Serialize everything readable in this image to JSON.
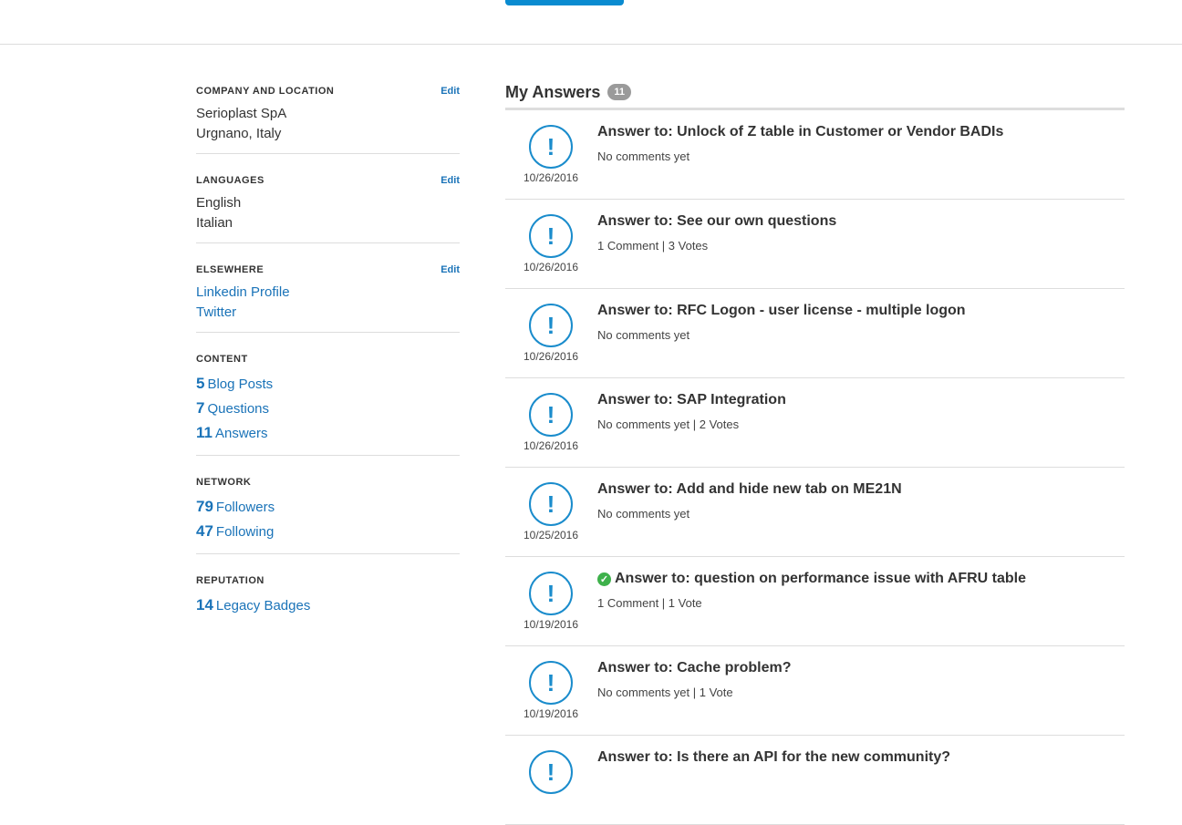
{
  "sidebar": {
    "edit_label": "Edit",
    "company": {
      "title": "COMPANY AND LOCATION",
      "name": "Serioplast SpA",
      "location": "Urgnano, Italy"
    },
    "languages": {
      "title": "LANGUAGES",
      "items": [
        "English",
        "Italian"
      ]
    },
    "elsewhere": {
      "title": "ELSEWHERE",
      "links": [
        "Linkedin Profile",
        "Twitter"
      ]
    },
    "content": {
      "title": "CONTENT",
      "stats": [
        {
          "count": "5",
          "label": "Blog Posts"
        },
        {
          "count": "7",
          "label": "Questions"
        },
        {
          "count": "11",
          "label": "Answers"
        }
      ]
    },
    "network": {
      "title": "NETWORK",
      "stats": [
        {
          "count": "79",
          "label": "Followers"
        },
        {
          "count": "47",
          "label": "Following"
        }
      ]
    },
    "reputation": {
      "title": "REPUTATION",
      "stats": [
        {
          "count": "14",
          "label": "Legacy Badges"
        }
      ]
    }
  },
  "answers": {
    "title": "My Answers",
    "count": "11",
    "icon": "exclamation-icon",
    "accent_color": "#1a8ccc",
    "accepted_color": "#3eb14b",
    "items": [
      {
        "title": "Answer to: Unlock of Z table in Customer or Vendor BADIs",
        "meta": "No comments yet",
        "date": "10/26/2016",
        "accepted": false
      },
      {
        "title": "Answer to: See our own questions",
        "meta": "1 Comment | 3 Votes",
        "date": "10/26/2016",
        "accepted": false
      },
      {
        "title": "Answer to: RFC Logon - user license - multiple logon",
        "meta": "No comments yet",
        "date": "10/26/2016",
        "accepted": false
      },
      {
        "title": "Answer to: SAP Integration",
        "meta": "No comments yet | 2 Votes",
        "date": "10/26/2016",
        "accepted": false
      },
      {
        "title": "Answer to: Add and hide new tab on ME21N",
        "meta": "No comments yet",
        "date": "10/25/2016",
        "accepted": false
      },
      {
        "title": "Answer to: question on performance issue with AFRU table",
        "meta": "1 Comment | 1 Vote",
        "date": "10/19/2016",
        "accepted": true
      },
      {
        "title": "Answer to: Cache problem?",
        "meta": "No comments yet | 1 Vote",
        "date": "10/19/2016",
        "accepted": false
      },
      {
        "title": "Answer to: Is there an API for the new community?",
        "meta": "",
        "date": "",
        "accepted": false
      }
    ]
  }
}
